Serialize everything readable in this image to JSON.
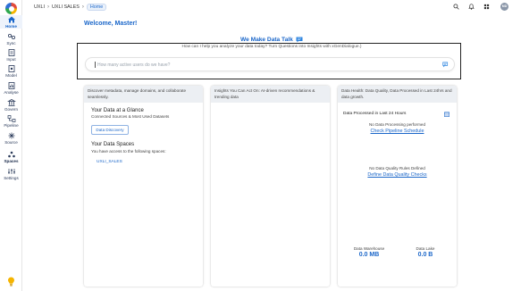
{
  "sidebar": {
    "items": [
      {
        "label": "Home",
        "icon": "home-icon"
      },
      {
        "label": "Sync",
        "icon": "sync-icon"
      },
      {
        "label": "Input",
        "icon": "input-icon"
      },
      {
        "label": "Model",
        "icon": "model-icon"
      },
      {
        "label": "Analyse",
        "icon": "analyse-icon"
      },
      {
        "label": "Govern",
        "icon": "govern-icon"
      },
      {
        "label": "Pipeline",
        "icon": "pipeline-icon"
      },
      {
        "label": "Source",
        "icon": "source-icon"
      },
      {
        "label": "Spaces",
        "icon": "spaces-icon"
      },
      {
        "label": "Settings",
        "icon": "settings-icon"
      }
    ]
  },
  "header": {
    "breadcrumbs": [
      "UXLI",
      "UXLI SALES",
      "Home"
    ],
    "avatar_initials": "MD"
  },
  "main": {
    "welcome": "Welcome, Master!",
    "tagline": "We Make Data Talk",
    "subtitle": "How can I help you analyze your data today? Turn Questions into Insights with xGenDialogue.)",
    "ask_placeholder": "How many active users do we have?"
  },
  "cards": {
    "discover": {
      "header": "Discover metadata, manage domains, and collaborate seamlessly.",
      "glance_title": "Your Data at a Glance",
      "glance_sub": "Connected Sources & Most Used Datasets",
      "discovery_button": "Data Discovery",
      "spaces_title": "Your Data Spaces",
      "spaces_sub": "You have access to the following spaces:",
      "spaces": [
        "UXLI_SALES"
      ]
    },
    "insights": {
      "header": "Insights You Can Act On: AI-driven recommendations & trending data"
    },
    "health": {
      "header": "Data Health: Data Quality, Data Processed in Last 24hrs and data growth.",
      "processed_title": "Data Processed in Last 24 Hours",
      "no_processing": "No Data Processing performed",
      "pipeline_link": "Check Pipeline Schedule",
      "no_rules": "No Data Quality Rules Defined",
      "rules_link": "Define Data Quality Checks",
      "warehouse_label": "Data Warehouse",
      "warehouse_value": "0.0 MB",
      "lake_label": "Data Lake",
      "lake_value": "0.0 B"
    }
  },
  "colors": {
    "accent": "#1a66c9",
    "card_header_bg": "#eceff3"
  }
}
